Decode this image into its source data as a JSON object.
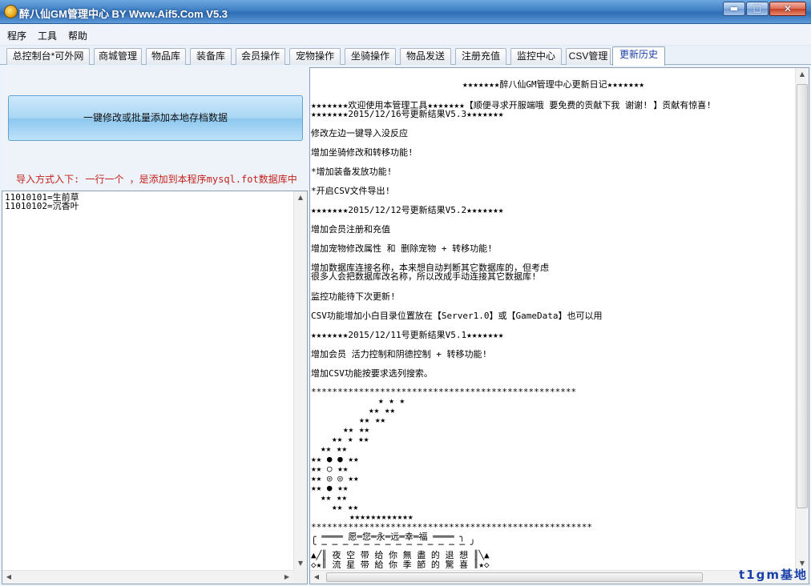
{
  "window": {
    "title": "醉八仙GM管理中心 BY Www.Aif5.Com  V5.3",
    "icon": "app-smiley-icon"
  },
  "menu": [
    "程序",
    "工具",
    "帮助"
  ],
  "tabs": [
    {
      "label": "总控制台*可外网"
    },
    {
      "label": "商城管理"
    },
    {
      "label": "物品库"
    },
    {
      "label": "装备库"
    },
    {
      "label": "会员操作"
    },
    {
      "label": "宠物操作"
    },
    {
      "label": "坐骑操作"
    },
    {
      "label": "物品发送"
    },
    {
      "label": "注册充值"
    },
    {
      "label": "监控中心"
    },
    {
      "label": "CSV管理"
    },
    {
      "label": "更新历史",
      "active": true
    }
  ],
  "left": {
    "big_button": "一键修改或批量添加本地存档数据",
    "hint": "导入方式入下:  一行一个 ，是添加到本程序mysql.fot数据库中",
    "textarea_lines": [
      "11010101=生前草",
      "11010102=沉香叶"
    ]
  },
  "log": {
    "heading": "★★★★★★★醉八仙GM管理中心更新日记★★★★★★★",
    "lines": [
      "★★★★★★★欢迎使用本管理工具★★★★★★★【顺便寻求开服端哦 要免费的贡献下我 谢谢! 】贡献有惊喜!",
      "★★★★★★★2015/12/16号更新结果V5.3★★★★★★★",
      "修改左边一键导入没反应",
      "增加坐骑修改和转移功能!",
      "*增加装备发放功能!",
      "*开启CSV文件导出!",
      "★★★★★★★2015/12/12号更新结果V5.2★★★★★★★",
      "增加会员注册和充值",
      "增加宠物修改属性 和 删除宠物 + 转移功能!",
      "增加数据库连接名称，本来想自动判断其它数据库的，但考虑",
      "很多人会把数据库改名称，所以改成手动连接其它数据库!",
      "监控功能待下次更新!",
      "CSV功能增加小白目录位置放在【Server1.0】或【GameData】也可以用",
      "★★★★★★★2015/12/11号更新结果V5.1★★★★★★★",
      "增加会员 活力控制和阴德控制 + 转移功能!",
      "增加CSV功能按要求选列搜索。",
      "**************************************************",
      "★ ★ ★",
      "★★ ★★",
      "★★ ★★",
      "★★ ★★",
      "★★ ★ ★★",
      "★★ ★★",
      "★★ ● ● ★★",
      "★★ ○ ★★",
      "★★ ◎ ◎ ★★",
      "★★ ● ★★",
      "★★ ★★",
      "★★ ★★",
      "★★★★★★★★★★★★",
      "*****************************************************",
      "╭ ════ 愿═您═永═远═幸═福 ════ ╮",
      "╰ ─ ─ ─ ─ ─ ─ ─ ─ ─ ─ ─ ─ ─ ─ ╯",
      "▲╱║ 夜 空 带 给 你 無 盡 的 退 想 ║╲▲",
      "◇★║ 流 星 带 給 你 季 節 的 驚 喜 ║★◇"
    ]
  },
  "watermark": "t1gm基地"
}
